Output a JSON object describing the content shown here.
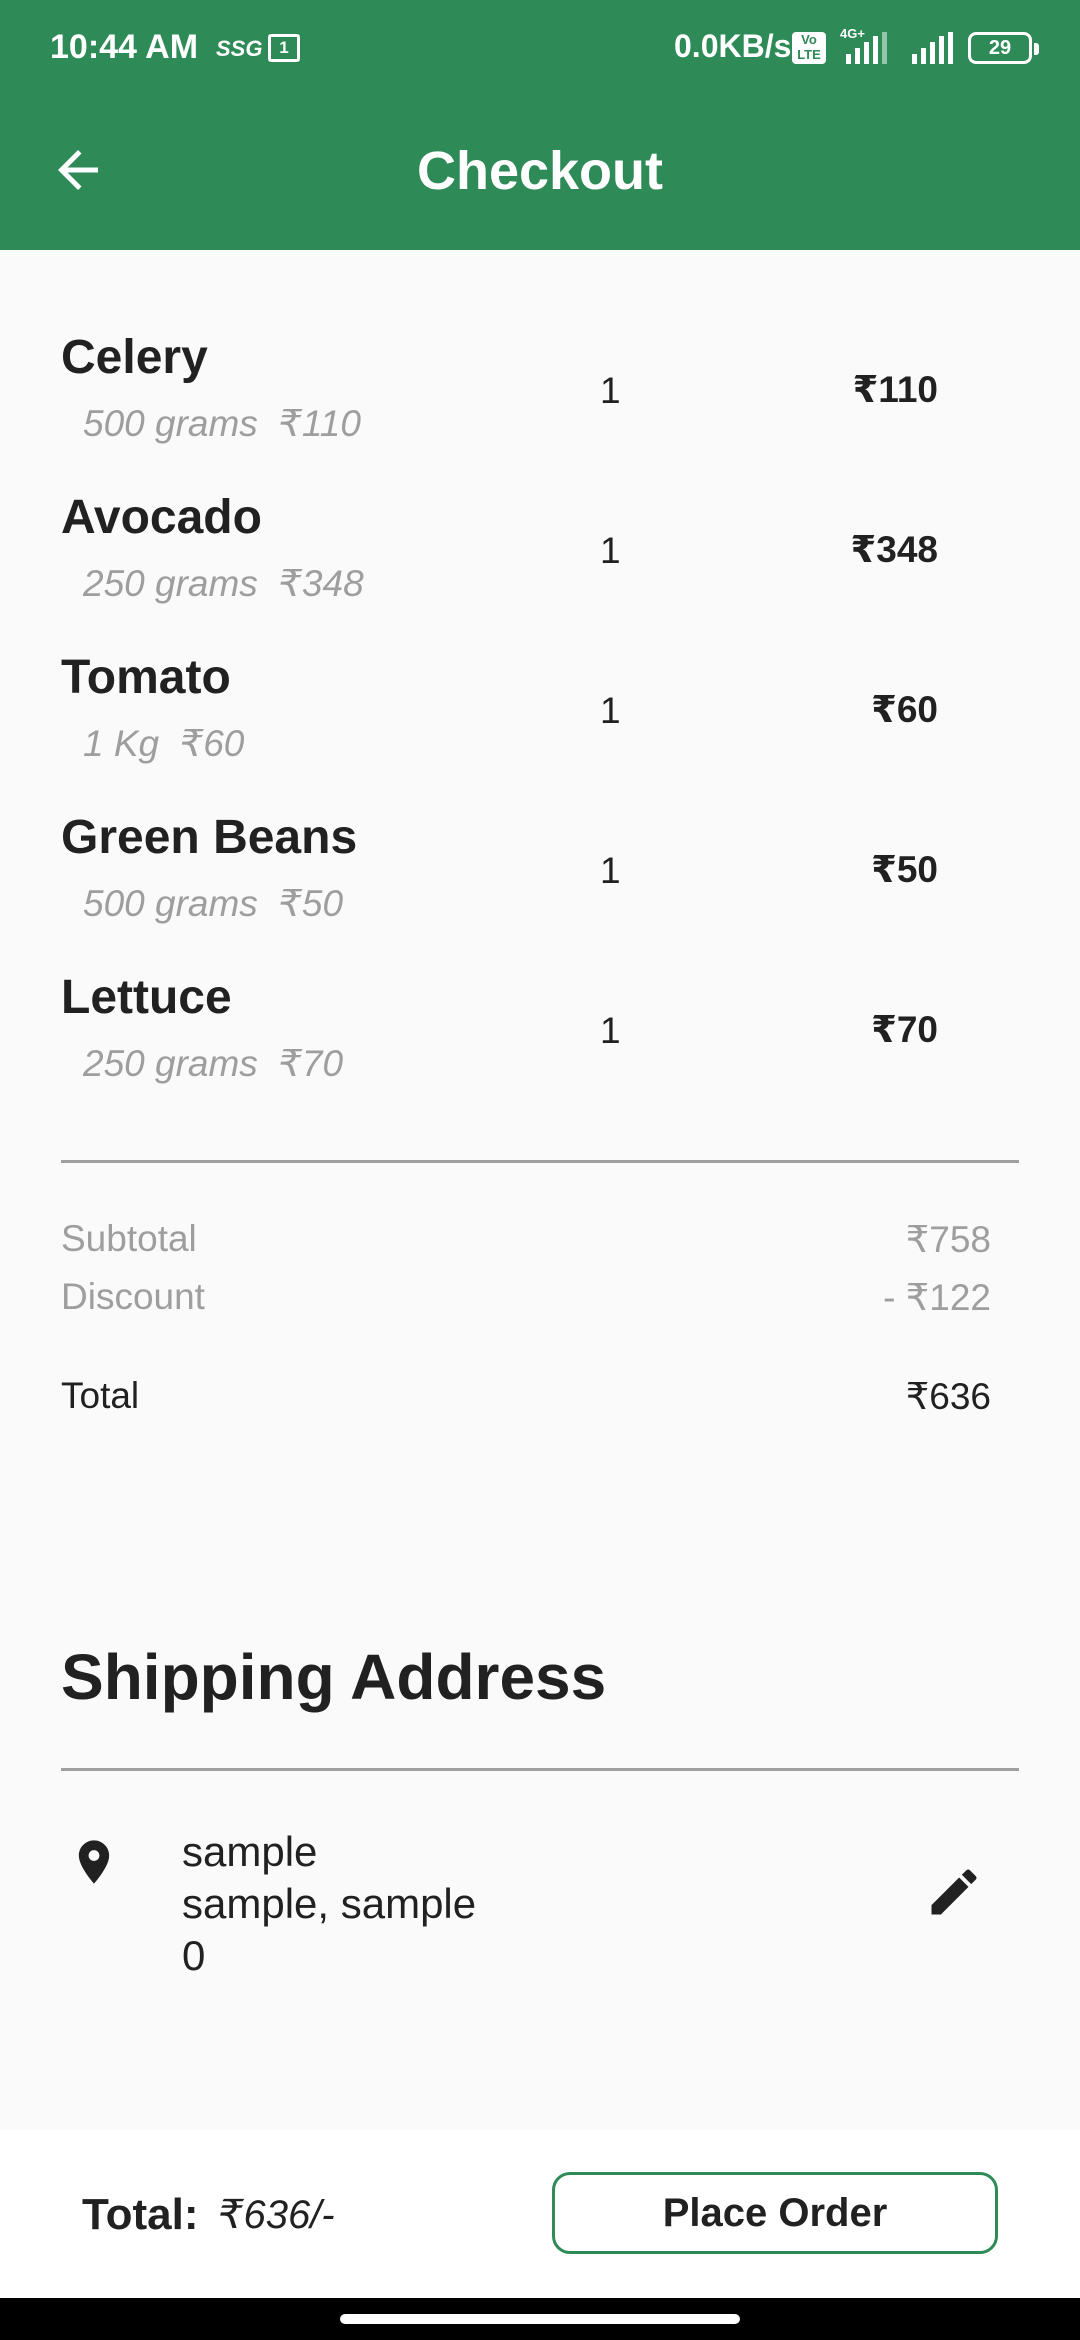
{
  "status_bar": {
    "time": "10:44 AM",
    "speed_icon": "SSG",
    "calendar_day": "1",
    "net_speed": "0.0KB/s",
    "volte_label": "Vo LTE",
    "network_type": "4G+",
    "battery": "29"
  },
  "app_bar": {
    "title": "Checkout",
    "back_icon": "arrow-back-icon"
  },
  "items": [
    {
      "name": "Celery",
      "weight": "500 grams",
      "unit_price": "₹110",
      "qty": "1",
      "price": "₹110"
    },
    {
      "name": "Avocado",
      "weight": "250 grams",
      "unit_price": "₹348",
      "qty": "1",
      "price": "₹348"
    },
    {
      "name": "Tomato",
      "weight": "1 Kg",
      "unit_price": "₹60",
      "qty": "1",
      "price": "₹60"
    },
    {
      "name": "Green Beans",
      "weight": "500 grams",
      "unit_price": "₹50",
      "qty": "1",
      "price": "₹50"
    },
    {
      "name": "Lettuce",
      "weight": "250 grams",
      "unit_price": "₹70",
      "qty": "1",
      "price": "₹70"
    }
  ],
  "summary": {
    "subtotal_label": "Subtotal",
    "subtotal_value": "₹758",
    "discount_label": "Discount",
    "discount_value": "- ₹122",
    "total_label": "Total",
    "total_value": "₹636"
  },
  "shipping": {
    "title": "Shipping Address",
    "line1": "sample",
    "line2": "sample, sample",
    "line3": "0",
    "pin_icon": "location-pin-icon",
    "edit_icon": "edit-pencil-icon"
  },
  "bottom_bar": {
    "total_label": "Total:",
    "total_value": "₹636/-",
    "place_order_label": "Place Order"
  },
  "colors": {
    "primary": "#2e8b57",
    "muted_text": "#9e9e9e",
    "text": "#212121",
    "background": "#fafafa"
  }
}
